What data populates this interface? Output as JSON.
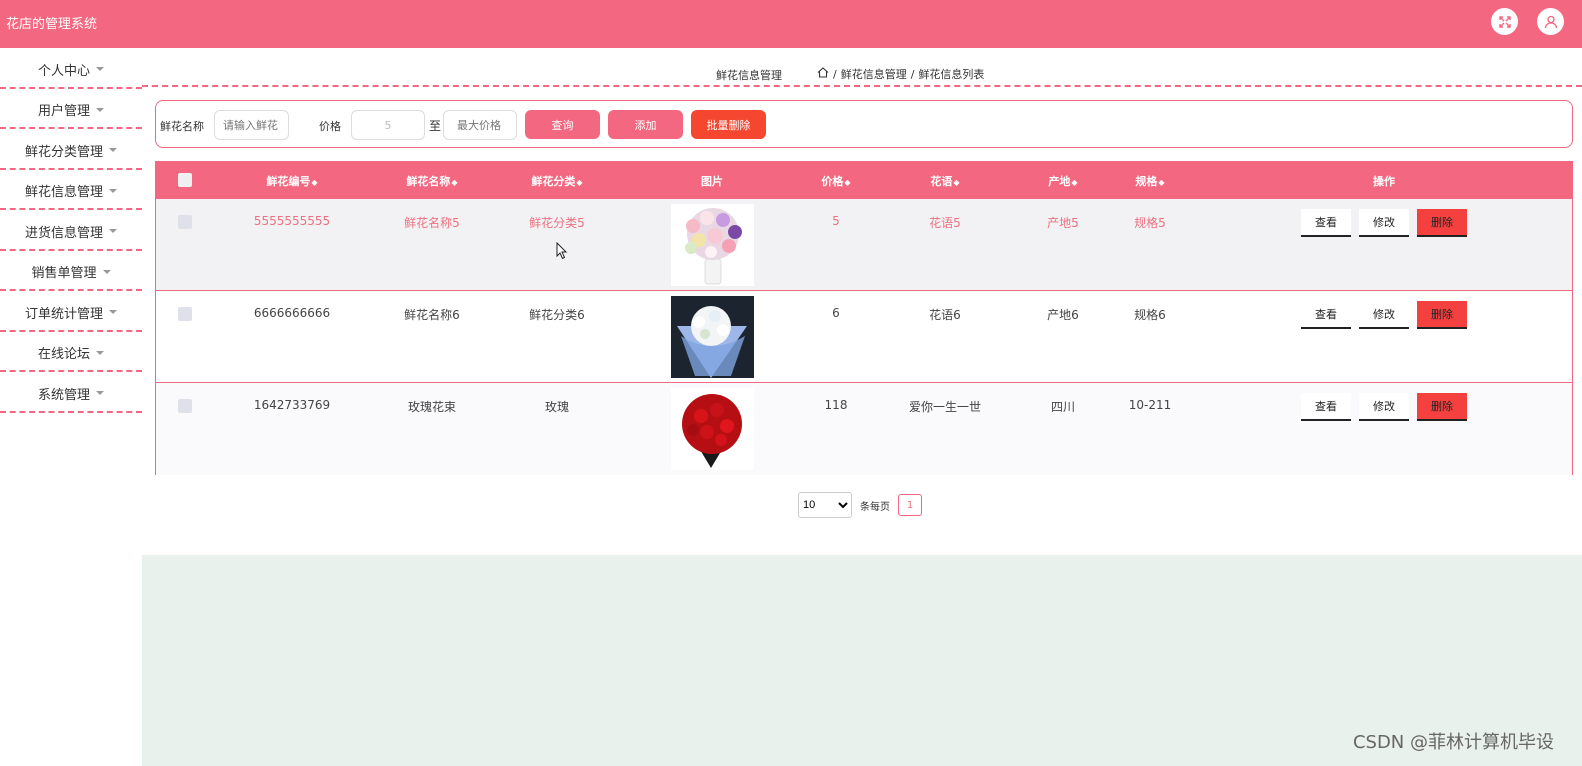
{
  "app": {
    "title": "花店的管理系统"
  },
  "icons": {
    "fullscreen": "fullscreen-icon",
    "user": "user-icon",
    "home": "home-icon",
    "caret": "caret-down-icon"
  },
  "colors": {
    "primary": "#f36880",
    "danger": "#f44140",
    "batch_delete": "#f5462f",
    "footer_bg": "#e8f1ec"
  },
  "sidebar": {
    "items": [
      {
        "label": "个人中心"
      },
      {
        "label": "用户管理"
      },
      {
        "label": "鲜花分类管理"
      },
      {
        "label": "鲜花信息管理"
      },
      {
        "label": "进货信息管理"
      },
      {
        "label": "销售单管理"
      },
      {
        "label": "订单统计管理"
      },
      {
        "label": "在线论坛"
      },
      {
        "label": "系统管理"
      }
    ]
  },
  "breadcrumb": {
    "title": "鲜花信息管理",
    "path": [
      "鲜花信息管理",
      "鲜花信息列表"
    ],
    "sep": "/"
  },
  "search": {
    "name_label": "鲜花名称",
    "name_placeholder": "请输入鲜花",
    "price_label": "价格",
    "min_price": "5",
    "to": "至",
    "max_placeholder": "最大价格",
    "query_btn": "查询",
    "add_btn": "添加",
    "batch_delete_btn": "批量删除"
  },
  "table": {
    "headers": [
      "鲜花编号",
      "鲜花名称",
      "鲜花分类",
      "图片",
      "价格",
      "花语",
      "产地",
      "规格",
      "操作"
    ],
    "sort_glyph": "◆",
    "rows": [
      {
        "id": "5555555555",
        "name": "鲜花名称5",
        "category": "鲜花分类5",
        "price": "5",
        "language": "花语5",
        "origin": "产地5",
        "spec": "规格5"
      },
      {
        "id": "6666666666",
        "name": "鲜花名称6",
        "category": "鲜花分类6",
        "price": "6",
        "language": "花语6",
        "origin": "产地6",
        "spec": "规格6"
      },
      {
        "id": "1642733769",
        "name": "玫瑰花束",
        "category": "玫瑰",
        "price": "118",
        "language": "爱你一生一世",
        "origin": "四川",
        "spec": "10-211"
      }
    ],
    "actions": {
      "view": "查看",
      "edit": "修改",
      "delete": "删除"
    }
  },
  "pagination": {
    "page_size": "10",
    "page_size_options": [
      "10"
    ],
    "per_page_label": "条每页",
    "current_page": "1"
  },
  "watermark": "CSDN @菲林计算机毕设"
}
